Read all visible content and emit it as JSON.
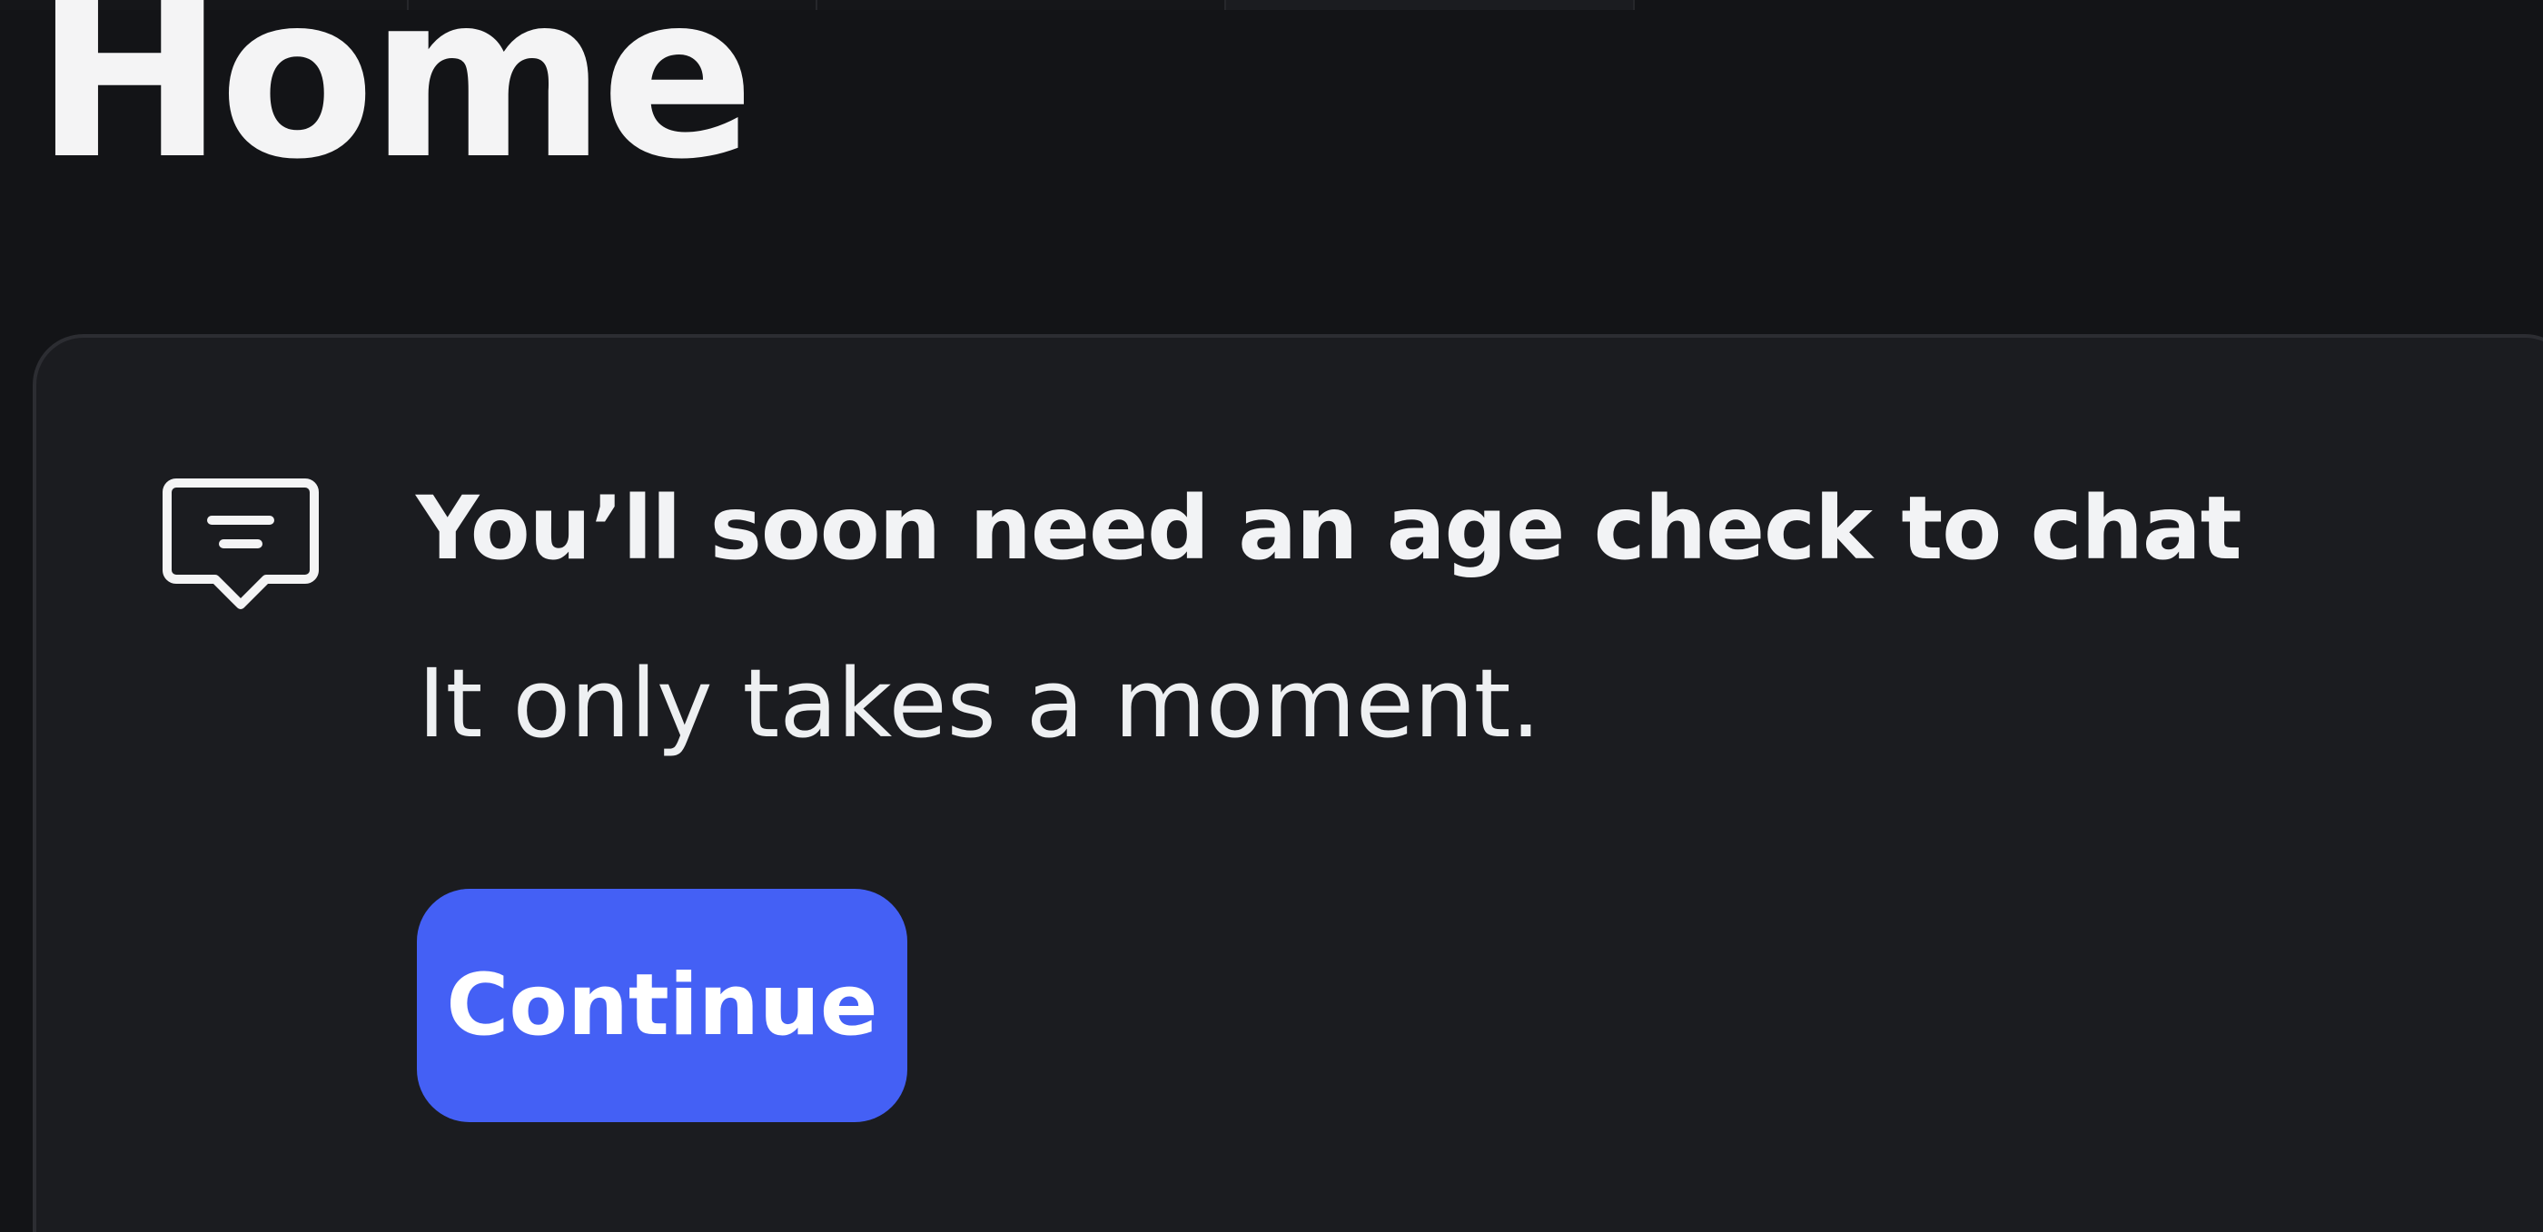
{
  "page": {
    "title": "Home"
  },
  "notice": {
    "icon": "chat-bubble-icon",
    "heading": "You’ll soon need an age check to chat",
    "subtext": "It only takes a moment.",
    "button_label": "Continue"
  },
  "colors": {
    "background": "#131417",
    "card": "#1b1c20",
    "accent": "#4460f5",
    "text": "#f2f3f5"
  }
}
